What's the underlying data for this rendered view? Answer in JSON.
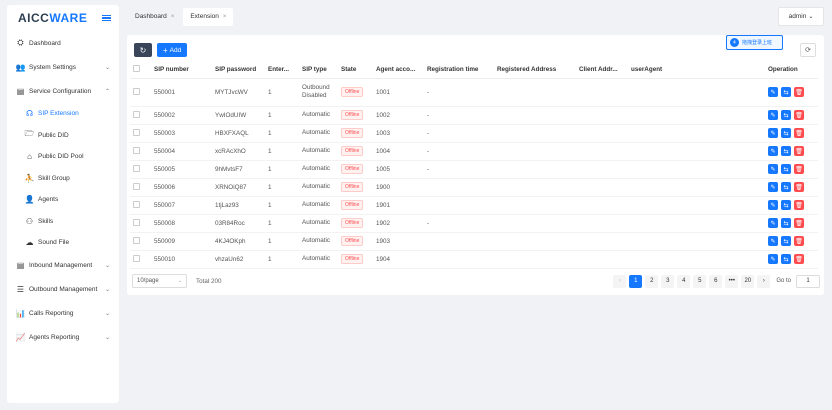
{
  "app": {
    "logo_main": "AICC",
    "logo_accent": "WARE",
    "colors": {
      "primary": "#1677ff",
      "danger": "#ff4d4f",
      "dark_button": "#3a4559"
    }
  },
  "sidebar": {
    "items": [
      {
        "label": "Dashboard",
        "icon": "dashboard-icon",
        "glyph": "⛭",
        "expandable": false
      },
      {
        "label": "System Settings",
        "icon": "users-icon",
        "glyph": "👥",
        "expandable": true,
        "chev": "⌄"
      },
      {
        "label": "Service Configuration",
        "icon": "service-config-icon",
        "glyph": "▤",
        "expandable": true,
        "chev": "⌃"
      },
      {
        "label": "SIP Extension",
        "icon": "headset-icon",
        "glyph": "☊",
        "sub": true,
        "active": true
      },
      {
        "label": "Public DID",
        "icon": "folder-icon",
        "glyph": "🗁",
        "sub": true
      },
      {
        "label": "Public DID Pool",
        "icon": "home-icon",
        "glyph": "⌂",
        "sub": true
      },
      {
        "label": "Skill Group",
        "icon": "skill-group-icon",
        "glyph": "⛹",
        "sub": true
      },
      {
        "label": "Agents",
        "icon": "agent-icon",
        "glyph": "👤",
        "sub": true
      },
      {
        "label": "Skills",
        "icon": "skills-icon",
        "glyph": "⚇",
        "sub": true
      },
      {
        "label": "Sound File",
        "icon": "cloud-icon",
        "glyph": "☁",
        "sub": true
      },
      {
        "label": "Inbound Management",
        "icon": "inbound-icon",
        "glyph": "▤",
        "expandable": true,
        "chev": "⌄"
      },
      {
        "label": "Outbound Management",
        "icon": "outbound-icon",
        "glyph": "☰",
        "expandable": true,
        "chev": "⌄"
      },
      {
        "label": "Calls Reporting",
        "icon": "bar-chart-icon",
        "glyph": "📊",
        "expandable": true,
        "chev": "⌄"
      },
      {
        "label": "Agents Reporting",
        "icon": "line-chart-icon",
        "glyph": "📈",
        "expandable": true,
        "chev": "⌄"
      }
    ]
  },
  "tabs": [
    {
      "label": "Dashboard",
      "close": "×",
      "active": false
    },
    {
      "label": "Extension",
      "close": "×",
      "active": true
    }
  ],
  "user": {
    "label": "admin",
    "chev": "⌄"
  },
  "toolbar": {
    "refresh_glyph": "↻",
    "add_label": "Add",
    "add_glyph": "+",
    "column_glyph": "⟳"
  },
  "float_badge": {
    "label": "拖拽登录上班",
    "glyph": "⚘"
  },
  "table": {
    "columns": [
      "SIP number",
      "SIP password",
      "Enter...",
      "SIP type",
      "State",
      "Agent acco...",
      "Registration time",
      "Registered Address",
      "Client Addr...",
      "userAgent",
      "Operation"
    ],
    "rows": [
      {
        "sip": "550001",
        "pwd": "MYTJvcWV",
        "enter": "1",
        "type": "Outbound Disabled",
        "state": "Offline",
        "agent": "1001",
        "reg": "-",
        "addr": "",
        "client": "",
        "ua": ""
      },
      {
        "sip": "550002",
        "pwd": "YwIOdUIW",
        "enter": "1",
        "type": "Automatic",
        "state": "Offline",
        "agent": "1002",
        "reg": "-",
        "addr": "",
        "client": "",
        "ua": ""
      },
      {
        "sip": "550003",
        "pwd": "HBXFXAQL",
        "enter": "1",
        "type": "Automatic",
        "state": "Offline",
        "agent": "1003",
        "reg": "-",
        "addr": "",
        "client": "",
        "ua": ""
      },
      {
        "sip": "550004",
        "pwd": "xcRAcXhO",
        "enter": "1",
        "type": "Automatic",
        "state": "Offline",
        "agent": "1004",
        "reg": "-",
        "addr": "",
        "client": "",
        "ua": ""
      },
      {
        "sip": "550005",
        "pwd": "9hMvtsF7",
        "enter": "1",
        "type": "Automatic",
        "state": "Offline",
        "agent": "1005",
        "reg": "-",
        "addr": "",
        "client": "",
        "ua": ""
      },
      {
        "sip": "550006",
        "pwd": "XRNOiQ87",
        "enter": "1",
        "type": "Automatic",
        "state": "Offline",
        "agent": "1900",
        "reg": "",
        "addr": "",
        "client": "",
        "ua": ""
      },
      {
        "sip": "550007",
        "pwd": "1tjLaz93",
        "enter": "1",
        "type": "Automatic",
        "state": "Offline",
        "agent": "1901",
        "reg": "",
        "addr": "",
        "client": "",
        "ua": ""
      },
      {
        "sip": "550008",
        "pwd": "03R84Roc",
        "enter": "1",
        "type": "Automatic",
        "state": "Offline",
        "agent": "1902",
        "reg": "-",
        "addr": "",
        "client": "",
        "ua": ""
      },
      {
        "sip": "550009",
        "pwd": "4KJ4OKph",
        "enter": "1",
        "type": "Automatic",
        "state": "Offline",
        "agent": "1903",
        "reg": "",
        "addr": "",
        "client": "",
        "ua": ""
      },
      {
        "sip": "550010",
        "pwd": "vhzaUn62",
        "enter": "1",
        "type": "Automatic",
        "state": "Offline",
        "agent": "1904",
        "reg": "",
        "addr": "",
        "client": "",
        "ua": ""
      }
    ],
    "op_glyphs": {
      "edit": "✎",
      "unbind": "⇆",
      "delete": "🗑"
    }
  },
  "pagination": {
    "page_size": "10/page",
    "page_size_chev": "⌄",
    "total": "Total 200",
    "prev": "‹",
    "next": "›",
    "pages": [
      "1",
      "2",
      "3",
      "4",
      "5",
      "6",
      "•••",
      "20"
    ],
    "current": "1",
    "goto_label": "Go to",
    "goto_value": "1"
  }
}
